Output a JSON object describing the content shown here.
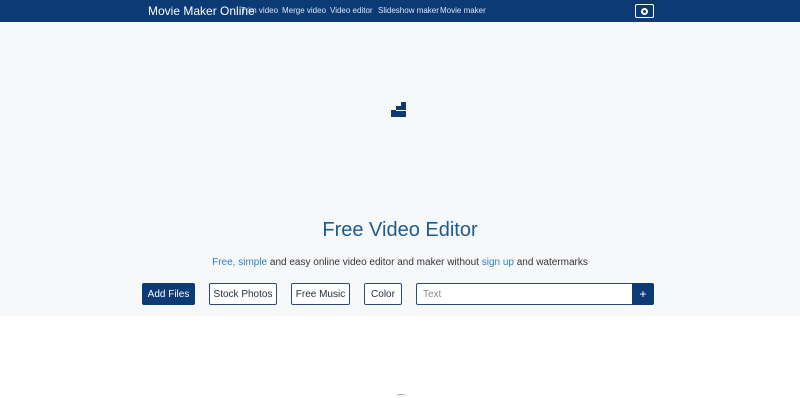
{
  "navbar": {
    "brand": "Movie Maker Online",
    "links": [
      "Trim video",
      "Merge video",
      "Video editor",
      "Slideshow maker",
      "Movie maker"
    ],
    "profile_icon": "user-circle-icon"
  },
  "hero": {
    "logo_icon": "stair-logo-icon",
    "title": "Free Video Editor",
    "subtitle": {
      "free": "Free,",
      "simple": "simple",
      "middle": "and easy online video editor and maker without",
      "signup": "sign up",
      "end": "and watermarks"
    },
    "buttons": {
      "add_files": "Add Files",
      "stock_photos": "Stock Photos",
      "free_music": "Free Music",
      "color": "Color"
    },
    "text_input": {
      "placeholder": "Text",
      "value": ""
    },
    "plus_label": "+"
  },
  "colors": {
    "navbar_bg": "#0b3a75",
    "title": "#1c5b8f",
    "link": "#2a7fb8",
    "hero_bg": "#f7f8fa"
  }
}
